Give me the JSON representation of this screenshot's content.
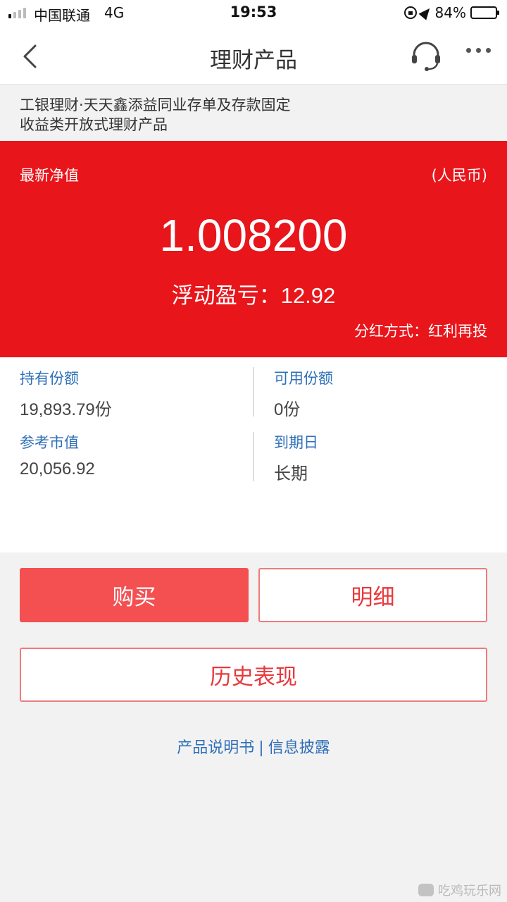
{
  "status_bar": {
    "carrier": "中国联通",
    "network": "4G",
    "time": "19:53",
    "battery": "84%",
    "battery_level": 0.84
  },
  "nav": {
    "title": "理财产品",
    "icons": [
      "back-icon",
      "headset-icon",
      "more-icon"
    ]
  },
  "product": {
    "name_line1": "工银理财·天天鑫添益同业存单及存款固定",
    "name_line2": "收益类开放式理财产品"
  },
  "nav_panel": {
    "label": "最新净值",
    "currency": "(人民币)",
    "value": "1.008200",
    "float_label": "浮动盈亏：",
    "float_value": "12.92",
    "dividend": "分红方式：红利再投",
    "accent_color": "#e8151b"
  },
  "holdings": {
    "held_label": "持有份额",
    "held_value": "19,893.79份",
    "available_label": "可用份额",
    "available_value": "0份",
    "market_label": "参考市值",
    "market_value": "20,056.92",
    "maturity_label": "到期日",
    "maturity_value": "长期"
  },
  "actions": {
    "buy": "购买",
    "detail": "明细",
    "history": "历史表现"
  },
  "footer": {
    "prospectus": "产品说明书",
    "separator": "|",
    "disclosure": "信息披露"
  },
  "watermark": "吃鸡玩乐网"
}
